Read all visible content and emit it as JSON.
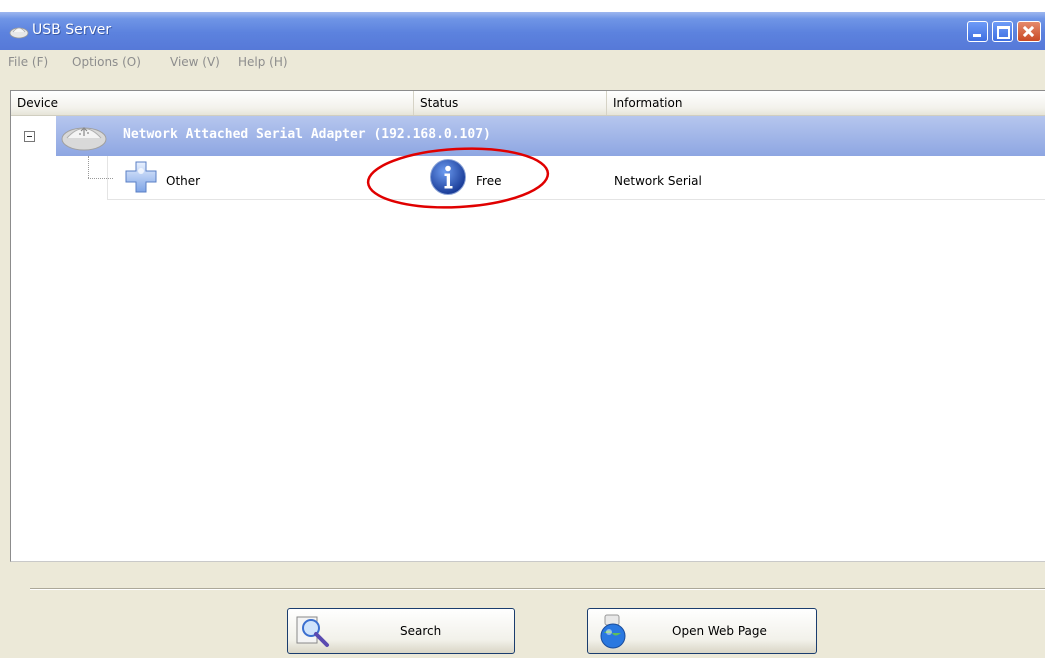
{
  "window": {
    "title": "USB Server",
    "controls": [
      "minimize-icon",
      "maximize-icon",
      "close-icon"
    ]
  },
  "menu": {
    "items": [
      {
        "label": "File (F)"
      },
      {
        "label": "Options (O)"
      },
      {
        "label": "View (V)"
      },
      {
        "label": "Help (H)"
      }
    ]
  },
  "table": {
    "columns": [
      "Device",
      "Status",
      "Information"
    ],
    "group": {
      "label": "Network Attached Serial Adapter  (192.168.0.107)",
      "icon": "usb-hub-icon",
      "expanded": true
    },
    "rows": [
      {
        "device": "Other",
        "status": "Free",
        "information": "Network Serial",
        "device_icon": "puzzle-piece-icon",
        "status_icon": "info-icon"
      }
    ]
  },
  "buttons": {
    "search_label": "Search",
    "web_label": "Open Web Page"
  },
  "colors": {
    "titlebar": "#5c82de",
    "group_band": "#8ea6e2",
    "annotation_ring": "#e00000",
    "info_icon": "#1f4fb8"
  }
}
